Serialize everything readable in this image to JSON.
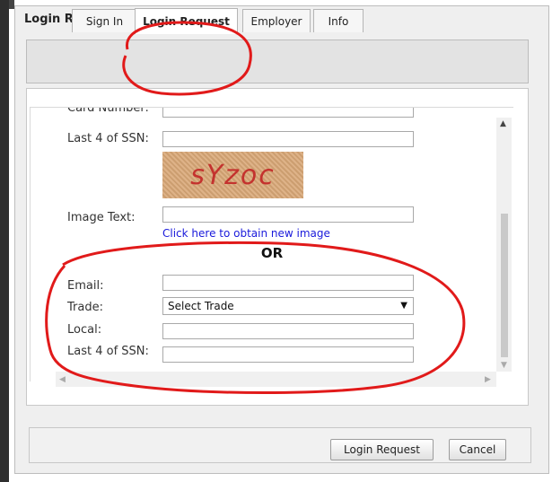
{
  "window": {
    "title": "Login Request"
  },
  "tabs": [
    {
      "label": "Sign In"
    },
    {
      "label": "Login Request"
    },
    {
      "label": "Employer"
    },
    {
      "label": "Info"
    }
  ],
  "form": {
    "card_number_label": "Card Number:",
    "ssn_label": "Last 4 of SSN:",
    "captcha_text": "sYzoc",
    "image_text_label": "Image Text:",
    "new_image_link": "Click here to obtain new image",
    "or_text": "OR",
    "email_label": "Email:",
    "trade_label": "Trade:",
    "trade_selected": "Select Trade",
    "local_label": "Local:",
    "ssn2_label": "Last 4 of SSN:"
  },
  "buttons": {
    "login_request": "Login Request",
    "cancel": "Cancel"
  },
  "annotation": {
    "color": "#e11a1a"
  }
}
